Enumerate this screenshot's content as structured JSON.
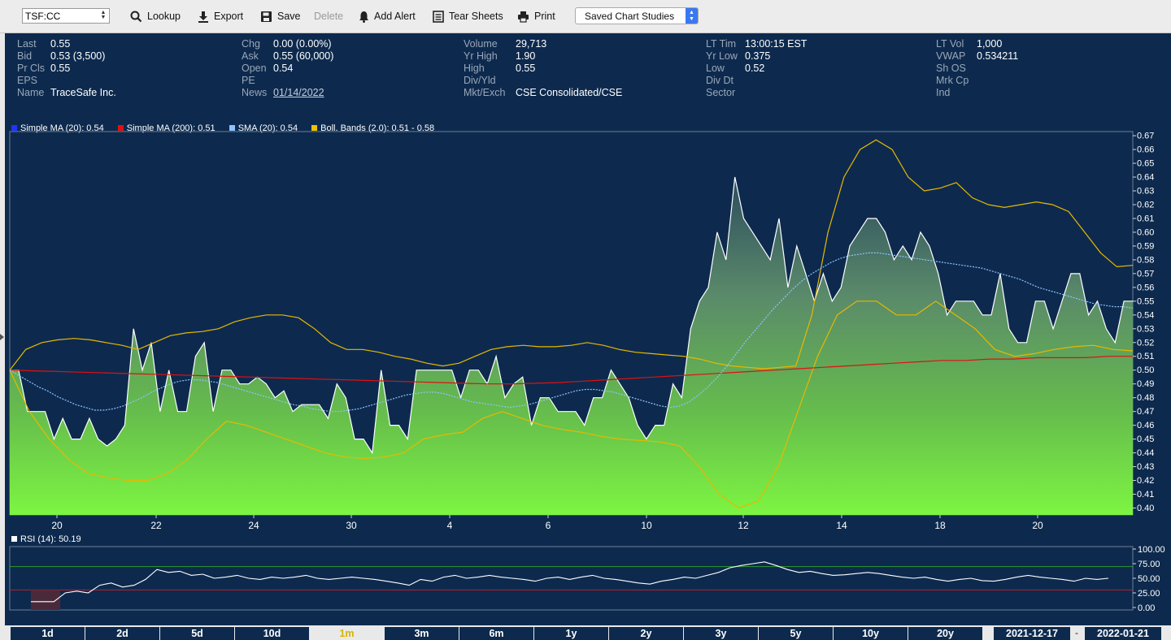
{
  "toolbar": {
    "symbol_value": "TSF:CC",
    "lookup_label": "Lookup",
    "export_label": "Export",
    "save_label": "Save",
    "delete_label": "Delete",
    "add_alert_label": "Add Alert",
    "tear_sheets_label": "Tear Sheets",
    "print_label": "Print",
    "saved_studies_label": "Saved Chart Studies"
  },
  "quote": {
    "col1": [
      {
        "k": "Last",
        "v": "0.55"
      },
      {
        "k": "Bid",
        "v": "0.53 (3,500)"
      },
      {
        "k": "Pr Cls",
        "v": "0.55"
      },
      {
        "k": "EPS",
        "v": ""
      },
      {
        "k": "Name",
        "v": "TraceSafe Inc."
      }
    ],
    "col2": [
      {
        "k": "Chg",
        "v": "0.00 (0.00%)"
      },
      {
        "k": "Ask",
        "v": "0.55 (60,000)"
      },
      {
        "k": "Open",
        "v": "0.54"
      },
      {
        "k": "PE",
        "v": ""
      },
      {
        "k": "News",
        "v": "01/14/2022"
      }
    ],
    "col3": [
      {
        "k": "Volume",
        "v": "29,713"
      },
      {
        "k": "Yr High",
        "v": "1.90"
      },
      {
        "k": "High",
        "v": "0.55"
      },
      {
        "k": "Div/Yld",
        "v": ""
      },
      {
        "k": "Mkt/Exch",
        "v": "CSE Consolidated/CSE"
      }
    ],
    "col4": [
      {
        "k": "LT Tim",
        "v": "13:00:15 EST"
      },
      {
        "k": "Yr Low",
        "v": "0.375"
      },
      {
        "k": "Low",
        "v": "0.52"
      },
      {
        "k": "Div Dt",
        "v": ""
      },
      {
        "k": "Sector",
        "v": ""
      }
    ],
    "col5": [
      {
        "k": "LT Vol",
        "v": "1,000"
      },
      {
        "k": "VWAP",
        "v": "0.534211"
      },
      {
        "k": "Sh OS",
        "v": ""
      },
      {
        "k": "Mrk Cp",
        "v": ""
      },
      {
        "k": "Ind",
        "v": ""
      }
    ]
  },
  "legend": [
    {
      "label": "Simple MA (20): 0.54",
      "color": "#2233ff"
    },
    {
      "label": "Simple MA (200): 0.51",
      "color": "#e01010"
    },
    {
      "label": "SMA (20): 0.54",
      "color": "#8fc3ff"
    },
    {
      "label": "Boll. Bands (2.0): 0.51 - 0.58",
      "color": "#f0c000"
    }
  ],
  "rsi_label": "RSI (14): 50.19",
  "ranges": [
    "1d",
    "2d",
    "5d",
    "10d",
    "1m",
    "3m",
    "6m",
    "1y",
    "2y",
    "3y",
    "5y",
    "10y",
    "20y"
  ],
  "active_range": "1m",
  "date_from": "2021-12-17",
  "date_sep": "-",
  "date_to": "2022-01-21",
  "chart_data": {
    "type": "area",
    "ylim": [
      0.395,
      0.673
    ],
    "yticks": [
      "0.67",
      "0.66",
      "0.65",
      "0.64",
      "0.63",
      "0.62",
      "0.61",
      "0.60",
      "0.59",
      "0.58",
      "0.57",
      "0.56",
      "0.55",
      "0.54",
      "0.53",
      "0.52",
      "0.51",
      "0.50",
      "0.49",
      "0.48",
      "0.47",
      "0.46",
      "0.45",
      "0.44",
      "0.43",
      "0.42",
      "0.41",
      "0.40"
    ],
    "xticks": [
      "20",
      "22",
      "24",
      "30",
      "4",
      "6",
      "10",
      "12",
      "14",
      "18",
      "20"
    ],
    "price": [
      0.5,
      0.5,
      0.47,
      0.47,
      0.47,
      0.45,
      0.465,
      0.45,
      0.45,
      0.465,
      0.45,
      0.445,
      0.45,
      0.46,
      0.53,
      0.5,
      0.52,
      0.47,
      0.5,
      0.47,
      0.47,
      0.51,
      0.52,
      0.47,
      0.5,
      0.5,
      0.49,
      0.49,
      0.495,
      0.49,
      0.48,
      0.485,
      0.47,
      0.475,
      0.475,
      0.475,
      0.465,
      0.49,
      0.48,
      0.45,
      0.45,
      0.44,
      0.5,
      0.46,
      0.46,
      0.45,
      0.5,
      0.5,
      0.5,
      0.5,
      0.5,
      0.48,
      0.5,
      0.5,
      0.49,
      0.51,
      0.48,
      0.49,
      0.495,
      0.46,
      0.48,
      0.48,
      0.47,
      0.47,
      0.47,
      0.46,
      0.48,
      0.48,
      0.5,
      0.49,
      0.48,
      0.46,
      0.45,
      0.46,
      0.46,
      0.49,
      0.48,
      0.53,
      0.55,
      0.56,
      0.6,
      0.58,
      0.64,
      0.61,
      0.6,
      0.59,
      0.58,
      0.61,
      0.56,
      0.59,
      0.57,
      0.55,
      0.57,
      0.55,
      0.56,
      0.59,
      0.6,
      0.61,
      0.61,
      0.6,
      0.58,
      0.59,
      0.58,
      0.6,
      0.59,
      0.57,
      0.54,
      0.55,
      0.55,
      0.55,
      0.54,
      0.54,
      0.57,
      0.53,
      0.52,
      0.52,
      0.55,
      0.55,
      0.53,
      0.55,
      0.57,
      0.57,
      0.54,
      0.55,
      0.53,
      0.52,
      0.55,
      0.55
    ],
    "sma20": [
      0.5,
      0.496,
      0.492,
      0.488,
      0.485,
      0.481,
      0.478,
      0.475,
      0.473,
      0.471,
      0.471,
      0.472,
      0.474,
      0.477,
      0.48,
      0.484,
      0.487,
      0.49,
      0.492,
      0.493,
      0.493,
      0.492,
      0.491,
      0.489,
      0.487,
      0.485,
      0.483,
      0.481,
      0.479,
      0.477,
      0.475,
      0.474,
      0.472,
      0.471,
      0.47,
      0.47,
      0.471,
      0.472,
      0.474,
      0.476,
      0.478,
      0.48,
      0.482,
      0.483,
      0.484,
      0.484,
      0.483,
      0.481,
      0.479,
      0.477,
      0.476,
      0.475,
      0.474,
      0.473,
      0.474,
      0.475,
      0.477,
      0.479,
      0.481,
      0.483,
      0.485,
      0.486,
      0.486,
      0.485,
      0.484,
      0.482,
      0.48,
      0.478,
      0.476,
      0.474,
      0.473,
      0.474,
      0.477,
      0.482,
      0.488,
      0.495,
      0.503,
      0.512,
      0.521,
      0.529,
      0.537,
      0.545,
      0.552,
      0.559,
      0.565,
      0.57,
      0.574,
      0.578,
      0.581,
      0.583,
      0.584,
      0.585,
      0.585,
      0.584,
      0.583,
      0.582,
      0.581,
      0.58,
      0.579,
      0.578,
      0.577,
      0.576,
      0.575,
      0.574,
      0.572,
      0.57,
      0.568,
      0.566,
      0.563,
      0.56,
      0.558,
      0.556,
      0.554,
      0.552,
      0.55,
      0.548,
      0.547,
      0.546,
      0.546,
      0.545
    ],
    "sma200": [
      0.5,
      0.4995,
      0.499,
      0.4985,
      0.498,
      0.4975,
      0.497,
      0.4965,
      0.496,
      0.4955,
      0.495,
      0.4945,
      0.494,
      0.4935,
      0.493,
      0.4925,
      0.492,
      0.4915,
      0.491,
      0.4905,
      0.49,
      0.49,
      0.4905,
      0.491,
      0.492,
      0.493,
      0.494,
      0.495,
      0.496,
      0.497,
      0.498,
      0.499,
      0.5,
      0.501,
      0.502,
      0.503,
      0.504,
      0.505,
      0.506,
      0.507,
      0.507,
      0.508,
      0.508,
      0.509,
      0.509,
      0.509,
      0.51,
      0.51
    ],
    "bb_upper": [
      0.5,
      0.515,
      0.52,
      0.522,
      0.523,
      0.522,
      0.52,
      0.518,
      0.515,
      0.52,
      0.525,
      0.527,
      0.528,
      0.53,
      0.535,
      0.538,
      0.54,
      0.54,
      0.538,
      0.53,
      0.52,
      0.515,
      0.515,
      0.513,
      0.51,
      0.508,
      0.505,
      0.503,
      0.505,
      0.51,
      0.515,
      0.517,
      0.518,
      0.517,
      0.517,
      0.518,
      0.52,
      0.518,
      0.515,
      0.513,
      0.512,
      0.511,
      0.51,
      0.508,
      0.505,
      0.503,
      0.502,
      0.501,
      0.502,
      0.503,
      0.54,
      0.6,
      0.64,
      0.66,
      0.667,
      0.66,
      0.64,
      0.63,
      0.632,
      0.636,
      0.625,
      0.62,
      0.618,
      0.62,
      0.622,
      0.62,
      0.615,
      0.6,
      0.585,
      0.575,
      0.576
    ],
    "bb_lower": [
      0.5,
      0.47,
      0.45,
      0.435,
      0.425,
      0.422,
      0.42,
      0.42,
      0.425,
      0.435,
      0.45,
      0.463,
      0.46,
      0.455,
      0.45,
      0.445,
      0.44,
      0.437,
      0.436,
      0.437,
      0.44,
      0.45,
      0.453,
      0.455,
      0.465,
      0.47,
      0.465,
      0.46,
      0.457,
      0.455,
      0.452,
      0.45,
      0.449,
      0.448,
      0.445,
      0.43,
      0.41,
      0.4,
      0.405,
      0.43,
      0.47,
      0.51,
      0.54,
      0.55,
      0.55,
      0.54,
      0.54,
      0.55,
      0.54,
      0.53,
      0.515,
      0.51,
      0.512,
      0.515,
      0.517,
      0.518,
      0.515,
      0.514
    ],
    "rsi": {
      "yticks": [
        "100.00",
        "75.00",
        "50.00",
        "25.00",
        "0.00"
      ],
      "ylim": [
        0,
        100
      ],
      "overbought": 70,
      "oversold": 30,
      "values": [
        10,
        10,
        10,
        25,
        28,
        25,
        38,
        42,
        35,
        38,
        48,
        65,
        60,
        62,
        55,
        57,
        50,
        52,
        55,
        50,
        48,
        52,
        50,
        52,
        55,
        50,
        48,
        50,
        52,
        50,
        48,
        45,
        42,
        38,
        48,
        45,
        52,
        55,
        50,
        52,
        55,
        52,
        50,
        48,
        45,
        50,
        52,
        48,
        52,
        55,
        50,
        48,
        45,
        42,
        40,
        45,
        48,
        52,
        50,
        55,
        60,
        68,
        72,
        75,
        78,
        72,
        65,
        60,
        62,
        58,
        55,
        56,
        58,
        60,
        58,
        55,
        52,
        50,
        52,
        48,
        45,
        48,
        50,
        46,
        45,
        48,
        52,
        55,
        52,
        50,
        48,
        45,
        50,
        48,
        50
      ]
    }
  }
}
